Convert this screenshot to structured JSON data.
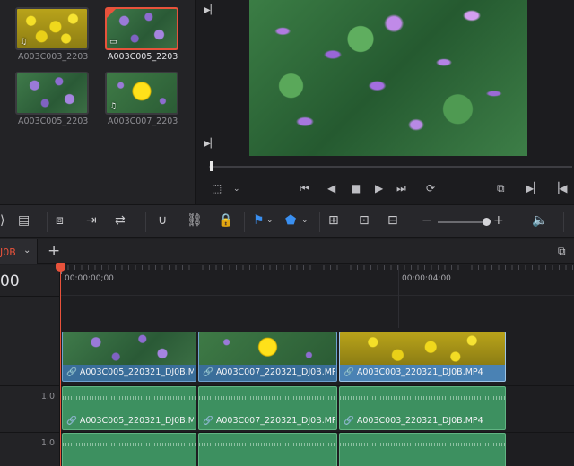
{
  "media_pool": {
    "clips": [
      {
        "name": "A003C003_2203",
        "badge": "♫",
        "selected": false
      },
      {
        "name": "A003C005_2203",
        "badge": "▭",
        "selected": true
      },
      {
        "name": "A003C005_2203",
        "badge": "",
        "selected": false
      },
      {
        "name": "A003C007_2203",
        "badge": "♫",
        "selected": false
      }
    ]
  },
  "viewer": {
    "transport_icons": [
      "crop-icon",
      "chevron-down-icon",
      "skip-back-icon",
      "step-back-icon",
      "stop-icon",
      "play-icon",
      "skip-forward-icon",
      "loop-icon",
      "match-frame-icon",
      "next-edit-icon",
      "prev-edit-icon"
    ]
  },
  "timeline": {
    "tab_label": "J0B",
    "timecode": "00",
    "ruler": {
      "label_start": "00:00:00;00",
      "label_4s": "00:00:04;00"
    },
    "audio_level_1": "1.0",
    "audio_level_2": "1.0",
    "video_clips": [
      {
        "name": "A003C005_220321_DJ0B.M..."
      },
      {
        "name": "A003C007_220321_DJ0B.MP4"
      },
      {
        "name": "A003C003_220321_DJ0B.MP4"
      }
    ],
    "audio_clips_a1": [
      {
        "name": "A003C005_220321_DJ0B.M..."
      },
      {
        "name": "A003C007_220321_DJ0B.MP4"
      },
      {
        "name": "A003C003_220321_DJ0B.MP4"
      }
    ]
  },
  "colors": {
    "accent": "#e8523b",
    "video_clip": "#3a6e9a",
    "audio_clip": "#3d9060"
  }
}
